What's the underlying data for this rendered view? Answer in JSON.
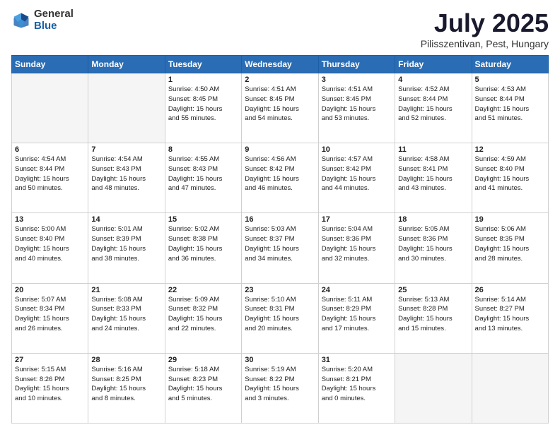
{
  "header": {
    "logo_general": "General",
    "logo_blue": "Blue",
    "month_year": "July 2025",
    "location": "Pilisszentivan, Pest, Hungary"
  },
  "weekdays": [
    "Sunday",
    "Monday",
    "Tuesday",
    "Wednesday",
    "Thursday",
    "Friday",
    "Saturday"
  ],
  "weeks": [
    [
      {
        "day": "",
        "info": ""
      },
      {
        "day": "",
        "info": ""
      },
      {
        "day": "1",
        "info": "Sunrise: 4:50 AM\nSunset: 8:45 PM\nDaylight: 15 hours\nand 55 minutes."
      },
      {
        "day": "2",
        "info": "Sunrise: 4:51 AM\nSunset: 8:45 PM\nDaylight: 15 hours\nand 54 minutes."
      },
      {
        "day": "3",
        "info": "Sunrise: 4:51 AM\nSunset: 8:45 PM\nDaylight: 15 hours\nand 53 minutes."
      },
      {
        "day": "4",
        "info": "Sunrise: 4:52 AM\nSunset: 8:44 PM\nDaylight: 15 hours\nand 52 minutes."
      },
      {
        "day": "5",
        "info": "Sunrise: 4:53 AM\nSunset: 8:44 PM\nDaylight: 15 hours\nand 51 minutes."
      }
    ],
    [
      {
        "day": "6",
        "info": "Sunrise: 4:54 AM\nSunset: 8:44 PM\nDaylight: 15 hours\nand 50 minutes."
      },
      {
        "day": "7",
        "info": "Sunrise: 4:54 AM\nSunset: 8:43 PM\nDaylight: 15 hours\nand 48 minutes."
      },
      {
        "day": "8",
        "info": "Sunrise: 4:55 AM\nSunset: 8:43 PM\nDaylight: 15 hours\nand 47 minutes."
      },
      {
        "day": "9",
        "info": "Sunrise: 4:56 AM\nSunset: 8:42 PM\nDaylight: 15 hours\nand 46 minutes."
      },
      {
        "day": "10",
        "info": "Sunrise: 4:57 AM\nSunset: 8:42 PM\nDaylight: 15 hours\nand 44 minutes."
      },
      {
        "day": "11",
        "info": "Sunrise: 4:58 AM\nSunset: 8:41 PM\nDaylight: 15 hours\nand 43 minutes."
      },
      {
        "day": "12",
        "info": "Sunrise: 4:59 AM\nSunset: 8:40 PM\nDaylight: 15 hours\nand 41 minutes."
      }
    ],
    [
      {
        "day": "13",
        "info": "Sunrise: 5:00 AM\nSunset: 8:40 PM\nDaylight: 15 hours\nand 40 minutes."
      },
      {
        "day": "14",
        "info": "Sunrise: 5:01 AM\nSunset: 8:39 PM\nDaylight: 15 hours\nand 38 minutes."
      },
      {
        "day": "15",
        "info": "Sunrise: 5:02 AM\nSunset: 8:38 PM\nDaylight: 15 hours\nand 36 minutes."
      },
      {
        "day": "16",
        "info": "Sunrise: 5:03 AM\nSunset: 8:37 PM\nDaylight: 15 hours\nand 34 minutes."
      },
      {
        "day": "17",
        "info": "Sunrise: 5:04 AM\nSunset: 8:36 PM\nDaylight: 15 hours\nand 32 minutes."
      },
      {
        "day": "18",
        "info": "Sunrise: 5:05 AM\nSunset: 8:36 PM\nDaylight: 15 hours\nand 30 minutes."
      },
      {
        "day": "19",
        "info": "Sunrise: 5:06 AM\nSunset: 8:35 PM\nDaylight: 15 hours\nand 28 minutes."
      }
    ],
    [
      {
        "day": "20",
        "info": "Sunrise: 5:07 AM\nSunset: 8:34 PM\nDaylight: 15 hours\nand 26 minutes."
      },
      {
        "day": "21",
        "info": "Sunrise: 5:08 AM\nSunset: 8:33 PM\nDaylight: 15 hours\nand 24 minutes."
      },
      {
        "day": "22",
        "info": "Sunrise: 5:09 AM\nSunset: 8:32 PM\nDaylight: 15 hours\nand 22 minutes."
      },
      {
        "day": "23",
        "info": "Sunrise: 5:10 AM\nSunset: 8:31 PM\nDaylight: 15 hours\nand 20 minutes."
      },
      {
        "day": "24",
        "info": "Sunrise: 5:11 AM\nSunset: 8:29 PM\nDaylight: 15 hours\nand 17 minutes."
      },
      {
        "day": "25",
        "info": "Sunrise: 5:13 AM\nSunset: 8:28 PM\nDaylight: 15 hours\nand 15 minutes."
      },
      {
        "day": "26",
        "info": "Sunrise: 5:14 AM\nSunset: 8:27 PM\nDaylight: 15 hours\nand 13 minutes."
      }
    ],
    [
      {
        "day": "27",
        "info": "Sunrise: 5:15 AM\nSunset: 8:26 PM\nDaylight: 15 hours\nand 10 minutes."
      },
      {
        "day": "28",
        "info": "Sunrise: 5:16 AM\nSunset: 8:25 PM\nDaylight: 15 hours\nand 8 minutes."
      },
      {
        "day": "29",
        "info": "Sunrise: 5:18 AM\nSunset: 8:23 PM\nDaylight: 15 hours\nand 5 minutes."
      },
      {
        "day": "30",
        "info": "Sunrise: 5:19 AM\nSunset: 8:22 PM\nDaylight: 15 hours\nand 3 minutes."
      },
      {
        "day": "31",
        "info": "Sunrise: 5:20 AM\nSunset: 8:21 PM\nDaylight: 15 hours\nand 0 minutes."
      },
      {
        "day": "",
        "info": ""
      },
      {
        "day": "",
        "info": ""
      }
    ]
  ]
}
